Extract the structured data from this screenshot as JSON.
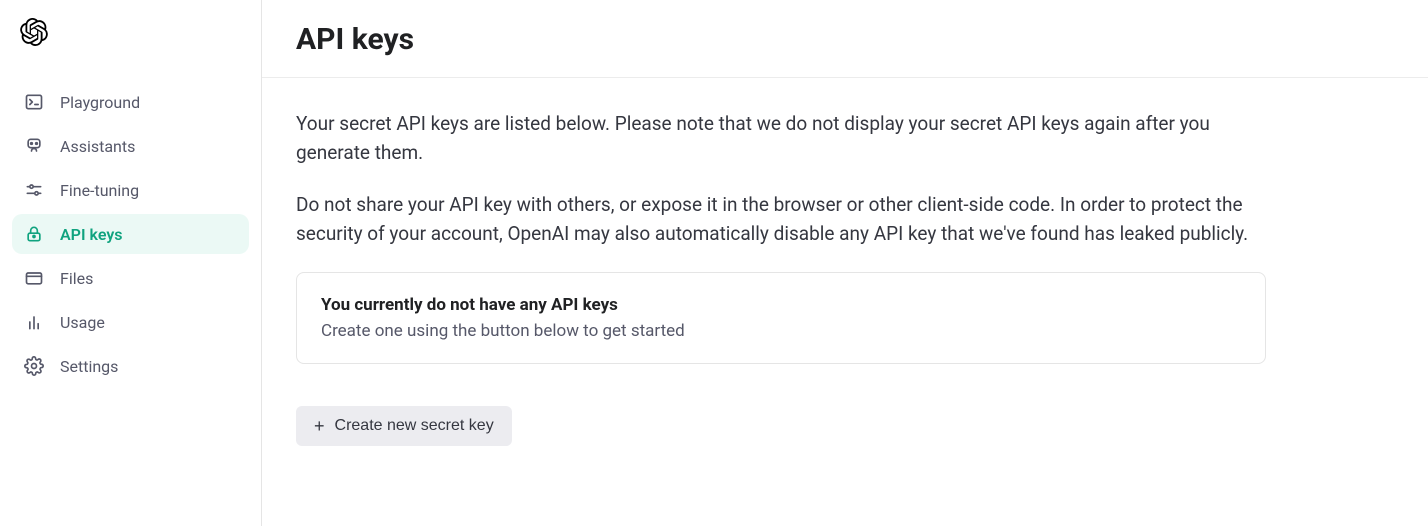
{
  "sidebar": {
    "items": [
      {
        "label": "Playground",
        "icon": "terminal-icon",
        "active": false
      },
      {
        "label": "Assistants",
        "icon": "robot-icon",
        "active": false
      },
      {
        "label": "Fine-tuning",
        "icon": "finetune-icon",
        "active": false
      },
      {
        "label": "API keys",
        "icon": "lock-icon",
        "active": true
      },
      {
        "label": "Files",
        "icon": "folder-icon",
        "active": false
      },
      {
        "label": "Usage",
        "icon": "chart-icon",
        "active": false
      },
      {
        "label": "Settings",
        "icon": "gear-icon",
        "active": false
      }
    ]
  },
  "page": {
    "title": "API keys",
    "description1": "Your secret API keys are listed below. Please note that we do not display your secret API keys again after you generate them.",
    "description2": "Do not share your API key with others, or expose it in the browser or other client-side code. In order to protect the security of your account, OpenAI may also automatically disable any API key that we've found has leaked publicly.",
    "empty_title": "You currently do not have any API keys",
    "empty_sub": "Create one using the button below to get started",
    "create_button": "Create new secret key"
  }
}
